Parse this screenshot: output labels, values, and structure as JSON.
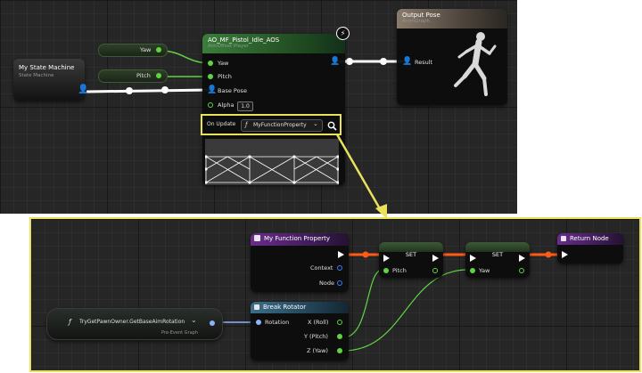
{
  "top_graph": {
    "state_machine": {
      "title": "My State Machine",
      "subtitle": "State Machine"
    },
    "yaw_var": {
      "label": "Yaw"
    },
    "pitch_var": {
      "label": "Pitch"
    },
    "aimoffset": {
      "title": "AO_MF_Pistol_Idle_AOS",
      "subtitle": "AimOffset Player",
      "pins": [
        "Yaw",
        "Pitch",
        "Base Pose",
        "Alpha"
      ],
      "alpha_value": "1.0",
      "on_update_label": "On Update",
      "function_label": "MyFunctionProperty",
      "lightning_glyph": "⚡"
    },
    "output_pose": {
      "title": "Output Pose",
      "subtitle": "AnimGraph",
      "result_label": "Result"
    }
  },
  "bottom_graph": {
    "function_entry": {
      "title": "My Function Property",
      "pins": [
        "Context",
        "Node"
      ]
    },
    "set1": {
      "title": "SET",
      "pin": "Pitch"
    },
    "set2": {
      "title": "SET",
      "pin": "Yaw"
    },
    "return_node": {
      "title": "Return Node"
    },
    "break_rotator": {
      "title": "Break Rotator",
      "input": "Rotation",
      "outputs": [
        "X (Roll)",
        "Y (Pitch)",
        "Z (Yaw)"
      ]
    },
    "get_aim": {
      "title": "TryGetPawnOwner.GetBaseAimRotation",
      "tag": "Pre-Event Graph"
    }
  },
  "colors": {
    "highlight": "#e9e15a",
    "exec_wire": "#ff5a16",
    "float_pin": "#5fd443",
    "struct_pin": "#3d7cff"
  },
  "icons": [
    "lightning-icon",
    "function-icon",
    "dropdown-icon",
    "search-icon",
    "pose-pin-icon",
    "exec-pin-icon"
  ]
}
